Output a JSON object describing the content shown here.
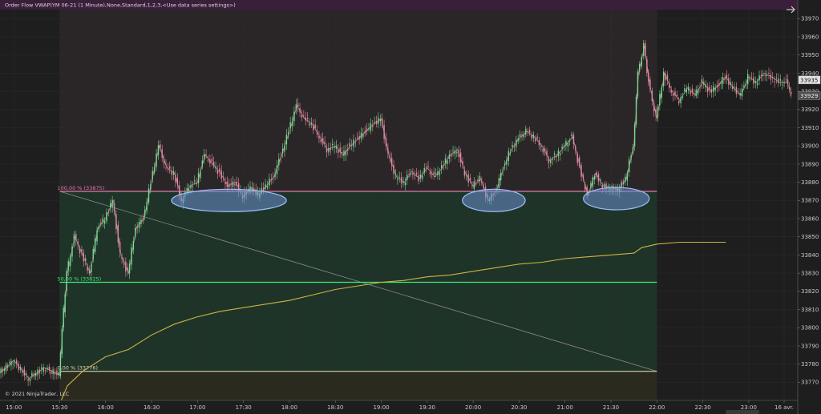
{
  "header": {
    "indicator_text": "Order Flow VWAP(YM 06-21 (1 Minute),None,Standard,1,2,3,<Use data series settings>)",
    "copyright": "© 2021 NinjaTrader, LLC"
  },
  "colors": {
    "background": "#1e1e1e",
    "session_shade": "#2a2628",
    "candle_up": "#7bd88f",
    "candle_down": "#e58aa0",
    "vwap": "#c9b642",
    "fib_100": "#e07aa8",
    "fib_50": "#3ee87a",
    "fib_0": "#d8d2b4",
    "zone_green": "#1f3528",
    "zone_olive": "#2b2a1d",
    "ellipse_fill": "#6a8fd0",
    "ellipse_stroke": "#9cc0ff",
    "top_bar": "#3a1f3b"
  },
  "chart_data": {
    "type": "candlestick",
    "title": "",
    "ylim": [
      33760,
      33975
    ],
    "y_ticks": [
      33770,
      33780,
      33790,
      33800,
      33810,
      33820,
      33830,
      33840,
      33850,
      33860,
      33870,
      33880,
      33890,
      33900,
      33910,
      33920,
      33930,
      33940,
      33950,
      33960,
      33970
    ],
    "x_ticks": [
      "15:00",
      "15:30",
      "16:00",
      "16:30",
      "17:00",
      "17:30",
      "18:00",
      "18:30",
      "19:00",
      "19:30",
      "20:00",
      "20:30",
      "21:00",
      "21:30",
      "22:00",
      "22:30",
      "23:00",
      "16 avr."
    ],
    "price_labels": {
      "last": 33935,
      "other": 33929
    },
    "fib_levels": [
      {
        "label": "100,00 % (33875)",
        "value": 33875
      },
      {
        "label": "50,00 % (33825)",
        "value": 33825
      },
      {
        "label": "0,00 % (33776)",
        "value": 33776
      }
    ],
    "price_series": [
      {
        "t": "14:51",
        "p": 33775
      },
      {
        "t": "15:00",
        "p": 33782
      },
      {
        "t": "15:10",
        "p": 33772
      },
      {
        "t": "15:20",
        "p": 33778
      },
      {
        "t": "15:30",
        "p": 33774
      },
      {
        "t": "15:32",
        "p": 33800
      },
      {
        "t": "15:35",
        "p": 33830
      },
      {
        "t": "15:40",
        "p": 33850
      },
      {
        "t": "15:45",
        "p": 33840
      },
      {
        "t": "15:50",
        "p": 33830
      },
      {
        "t": "15:55",
        "p": 33855
      },
      {
        "t": "16:00",
        "p": 33860
      },
      {
        "t": "16:05",
        "p": 33870
      },
      {
        "t": "16:10",
        "p": 33840
      },
      {
        "t": "16:15",
        "p": 33830
      },
      {
        "t": "16:20",
        "p": 33855
      },
      {
        "t": "16:25",
        "p": 33860
      },
      {
        "t": "16:30",
        "p": 33880
      },
      {
        "t": "16:35",
        "p": 33900
      },
      {
        "t": "16:40",
        "p": 33888
      },
      {
        "t": "16:45",
        "p": 33885
      },
      {
        "t": "16:50",
        "p": 33870
      },
      {
        "t": "16:55",
        "p": 33878
      },
      {
        "t": "17:00",
        "p": 33880
      },
      {
        "t": "17:05",
        "p": 33895
      },
      {
        "t": "17:10",
        "p": 33890
      },
      {
        "t": "17:15",
        "p": 33885
      },
      {
        "t": "17:20",
        "p": 33878
      },
      {
        "t": "17:25",
        "p": 33880
      },
      {
        "t": "17:30",
        "p": 33872
      },
      {
        "t": "17:35",
        "p": 33877
      },
      {
        "t": "17:40",
        "p": 33873
      },
      {
        "t": "17:45",
        "p": 33878
      },
      {
        "t": "17:50",
        "p": 33883
      },
      {
        "t": "17:55",
        "p": 33895
      },
      {
        "t": "18:00",
        "p": 33908
      },
      {
        "t": "18:05",
        "p": 33922
      },
      {
        "t": "18:10",
        "p": 33915
      },
      {
        "t": "18:15",
        "p": 33912
      },
      {
        "t": "18:20",
        "p": 33905
      },
      {
        "t": "18:25",
        "p": 33898
      },
      {
        "t": "18:30",
        "p": 33900
      },
      {
        "t": "18:35",
        "p": 33895
      },
      {
        "t": "18:40",
        "p": 33900
      },
      {
        "t": "18:45",
        "p": 33904
      },
      {
        "t": "18:50",
        "p": 33908
      },
      {
        "t": "18:55",
        "p": 33912
      },
      {
        "t": "19:00",
        "p": 33915
      },
      {
        "t": "19:05",
        "p": 33895
      },
      {
        "t": "19:10",
        "p": 33883
      },
      {
        "t": "19:15",
        "p": 33880
      },
      {
        "t": "19:20",
        "p": 33886
      },
      {
        "t": "19:25",
        "p": 33882
      },
      {
        "t": "19:30",
        "p": 33888
      },
      {
        "t": "19:35",
        "p": 33883
      },
      {
        "t": "19:40",
        "p": 33888
      },
      {
        "t": "19:45",
        "p": 33895
      },
      {
        "t": "19:50",
        "p": 33898
      },
      {
        "t": "19:55",
        "p": 33885
      },
      {
        "t": "20:00",
        "p": 33878
      },
      {
        "t": "20:05",
        "p": 33882
      },
      {
        "t": "20:10",
        "p": 33870
      },
      {
        "t": "20:15",
        "p": 33875
      },
      {
        "t": "20:20",
        "p": 33888
      },
      {
        "t": "20:25",
        "p": 33898
      },
      {
        "t": "20:30",
        "p": 33904
      },
      {
        "t": "20:35",
        "p": 33908
      },
      {
        "t": "20:40",
        "p": 33905
      },
      {
        "t": "20:45",
        "p": 33900
      },
      {
        "t": "20:50",
        "p": 33892
      },
      {
        "t": "20:55",
        "p": 33895
      },
      {
        "t": "21:00",
        "p": 33900
      },
      {
        "t": "21:05",
        "p": 33905
      },
      {
        "t": "21:10",
        "p": 33888
      },
      {
        "t": "21:15",
        "p": 33873
      },
      {
        "t": "21:20",
        "p": 33885
      },
      {
        "t": "21:25",
        "p": 33878
      },
      {
        "t": "21:30",
        "p": 33877
      },
      {
        "t": "21:35",
        "p": 33876
      },
      {
        "t": "21:40",
        "p": 33882
      },
      {
        "t": "21:45",
        "p": 33900
      },
      {
        "t": "21:48",
        "p": 33940
      },
      {
        "t": "21:52",
        "p": 33955
      },
      {
        "t": "21:55",
        "p": 33935
      },
      {
        "t": "22:00",
        "p": 33915
      },
      {
        "t": "22:05",
        "p": 33940
      },
      {
        "t": "22:10",
        "p": 33930
      },
      {
        "t": "22:15",
        "p": 33925
      },
      {
        "t": "22:20",
        "p": 33932
      },
      {
        "t": "22:25",
        "p": 33928
      },
      {
        "t": "22:30",
        "p": 33935
      },
      {
        "t": "22:35",
        "p": 33930
      },
      {
        "t": "22:40",
        "p": 33933
      },
      {
        "t": "22:45",
        "p": 33938
      },
      {
        "t": "22:50",
        "p": 33932
      },
      {
        "t": "22:55",
        "p": 33928
      },
      {
        "t": "23:00",
        "p": 33938
      },
      {
        "t": "23:05",
        "p": 33935
      },
      {
        "t": "23:10",
        "p": 33940
      },
      {
        "t": "23:15",
        "p": 33938
      },
      {
        "t": "23:20",
        "p": 33935
      },
      {
        "t": "23:25",
        "p": 33935
      },
      {
        "t": "23:28",
        "p": 33929
      }
    ],
    "vwap_series": [
      {
        "t": "15:31",
        "p": 33760
      },
      {
        "t": "15:35",
        "p": 33768
      },
      {
        "t": "15:45",
        "p": 33776
      },
      {
        "t": "16:00",
        "p": 33784
      },
      {
        "t": "16:15",
        "p": 33788
      },
      {
        "t": "16:30",
        "p": 33796
      },
      {
        "t": "16:45",
        "p": 33802
      },
      {
        "t": "17:00",
        "p": 33806
      },
      {
        "t": "17:15",
        "p": 33809
      },
      {
        "t": "17:30",
        "p": 33811
      },
      {
        "t": "17:45",
        "p": 33813
      },
      {
        "t": "18:00",
        "p": 33815
      },
      {
        "t": "18:15",
        "p": 33818
      },
      {
        "t": "18:30",
        "p": 33821
      },
      {
        "t": "18:45",
        "p": 33823
      },
      {
        "t": "19:00",
        "p": 33825
      },
      {
        "t": "19:15",
        "p": 33826
      },
      {
        "t": "19:30",
        "p": 33828
      },
      {
        "t": "19:45",
        "p": 33829
      },
      {
        "t": "20:00",
        "p": 33831
      },
      {
        "t": "20:15",
        "p": 33833
      },
      {
        "t": "20:30",
        "p": 33835
      },
      {
        "t": "20:45",
        "p": 33836
      },
      {
        "t": "21:00",
        "p": 33838
      },
      {
        "t": "21:15",
        "p": 33839
      },
      {
        "t": "21:30",
        "p": 33840
      },
      {
        "t": "21:45",
        "p": 33841
      },
      {
        "t": "21:50",
        "p": 33844
      },
      {
        "t": "22:00",
        "p": 33846
      },
      {
        "t": "22:15",
        "p": 33847
      },
      {
        "t": "22:45",
        "p": 33847
      }
    ],
    "highlight_ellipses": [
      {
        "t_from": "16:43",
        "t_to": "17:58",
        "p_center": 33870
      },
      {
        "t_from": "19:53",
        "t_to": "20:34",
        "p_center": 33870
      },
      {
        "t_from": "21:12",
        "t_to": "21:55",
        "p_center": 33871
      }
    ],
    "trend_line": {
      "t_from": "15:30",
      "p_from": 33875,
      "t_to": "22:00",
      "p_to": 33776
    },
    "fib_range": {
      "t_from": "15:30",
      "t_to": "22:00"
    },
    "session_shade": {
      "t_from": "15:30",
      "t_to": "22:00"
    }
  }
}
